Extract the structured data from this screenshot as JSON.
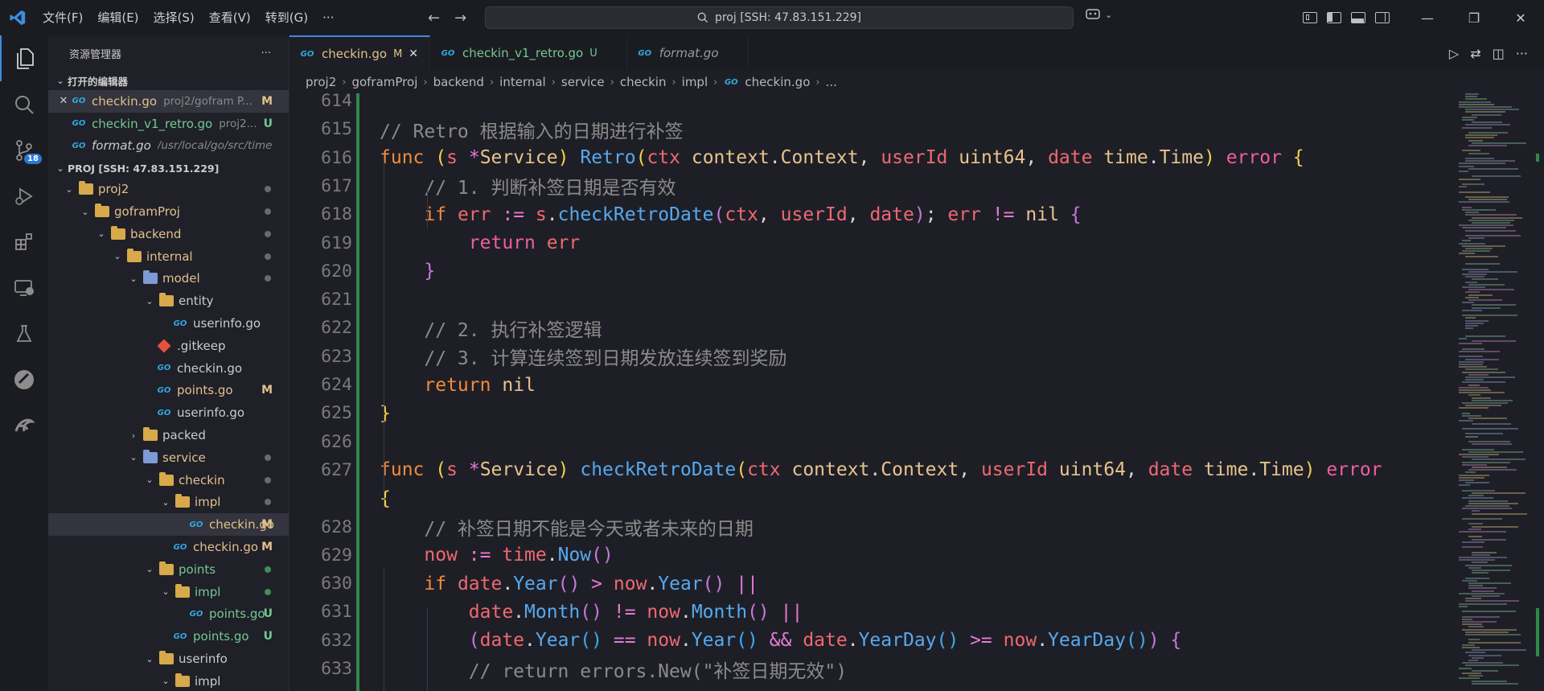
{
  "menu": [
    "文件(F)",
    "编辑(E)",
    "选择(S)",
    "查看(V)",
    "转到(G)",
    "···"
  ],
  "search": {
    "text": "proj [SSH: 47.83.151.229]"
  },
  "activity_badge": "18",
  "sidebar": {
    "title": "资源管理器",
    "more": "···",
    "open_editors_label": "打开的编辑器",
    "open_editors": [
      {
        "name": "checkin.go",
        "desc": "proj2/gofram P...",
        "status": "M",
        "close": "✕"
      },
      {
        "name": "checkin_v1_retro.go",
        "desc": "proj2...",
        "status": "U"
      },
      {
        "name": "format.go",
        "desc": "/usr/local/go/src/time",
        "status": ""
      }
    ],
    "project_label": "PROJ [SSH: 47.83.151.229]",
    "tree": [
      {
        "name": "proj2",
        "type": "folder",
        "chev": "⌄",
        "level": 0,
        "marker": "dot"
      },
      {
        "name": "goframProj",
        "type": "folder",
        "chev": "⌄",
        "level": 1,
        "marker": "dot"
      },
      {
        "name": "backend",
        "type": "folder",
        "chev": "⌄",
        "level": 2,
        "marker": "dot"
      },
      {
        "name": "internal",
        "type": "folder",
        "chev": "⌄",
        "level": 3,
        "marker": "dot"
      },
      {
        "name": "model",
        "type": "special",
        "chev": "⌄",
        "level": 4,
        "marker": "dot"
      },
      {
        "name": "entity",
        "type": "folder",
        "chev": "⌄",
        "level": 5,
        "marker": ""
      },
      {
        "name": "userinfo.go",
        "type": "go",
        "level": 6,
        "marker": ""
      },
      {
        "name": ".gitkeep",
        "type": "git",
        "level": 5,
        "marker": ""
      },
      {
        "name": "checkin.go",
        "type": "go",
        "level": 5,
        "marker": ""
      },
      {
        "name": "points.go",
        "type": "go",
        "level": 5,
        "marker": "M"
      },
      {
        "name": "userinfo.go",
        "type": "go",
        "level": 5,
        "marker": ""
      },
      {
        "name": "packed",
        "type": "folder",
        "chev": "›",
        "level": 4,
        "marker": ""
      },
      {
        "name": "service",
        "type": "special",
        "chev": "⌄",
        "level": 4,
        "marker": "dot"
      },
      {
        "name": "checkin",
        "type": "folder",
        "chev": "⌄",
        "level": 5,
        "marker": "dot"
      },
      {
        "name": "impl",
        "type": "folder",
        "chev": "⌄",
        "level": 6,
        "marker": "dot"
      },
      {
        "name": "checkin.go",
        "type": "go",
        "level": 7,
        "marker": "M",
        "selected": true
      },
      {
        "name": "checkin.go",
        "type": "go",
        "level": 6,
        "marker": "M"
      },
      {
        "name": "points",
        "type": "folder",
        "chev": "⌄",
        "level": 5,
        "marker": "greendot"
      },
      {
        "name": "impl",
        "type": "folder",
        "chev": "⌄",
        "level": 6,
        "marker": "greendot"
      },
      {
        "name": "points.go",
        "type": "go",
        "level": 7,
        "marker": "U"
      },
      {
        "name": "points.go",
        "type": "go",
        "level": 6,
        "marker": "U"
      },
      {
        "name": "userinfo",
        "type": "folder",
        "chev": "⌄",
        "level": 5,
        "marker": ""
      },
      {
        "name": "impl",
        "type": "folder",
        "chev": "⌄",
        "level": 6,
        "marker": ""
      }
    ]
  },
  "tabs": [
    {
      "name": "checkin.go",
      "status": "M",
      "close": "✕",
      "active": true
    },
    {
      "name": "checkin_v1_retro.go",
      "status": "U"
    },
    {
      "name": "format.go",
      "status": ""
    }
  ],
  "breadcrumb": [
    "proj2",
    "goframProj",
    "backend",
    "internal",
    "service",
    "checkin",
    "impl",
    "checkin.go",
    "..."
  ],
  "code_lines": [
    {
      "n": "614",
      "html": ""
    },
    {
      "n": "615",
      "html": "<span class='cm'>// Retro 根据输入的日期进行补签</span>"
    },
    {
      "n": "616",
      "html": "<span class='kw'>func</span> <span class='br1'>(</span><span class='pa'>s</span> <span class='op'>*</span><span class='ty'>Service</span><span class='br1'>)</span> <span class='fn'>Retro</span><span class='br1'>(</span><span class='pa'>ctx</span> <span class='ty'>context</span><span class='tx'>.</span><span class='ty'>Context</span><span class='tx'>,</span> <span class='pa'>userId</span> <span class='ty'>uint64</span><span class='tx'>,</span> <span class='pa'>date</span> <span class='ty'>time</span><span class='tx'>.</span><span class='ty'>Time</span><span class='br1'>)</span> <span class='pink'>error</span> <span class='br1'>{</span>"
    },
    {
      "n": "617",
      "html": "    <span class='cm'>// 1. 判断补签日期是否有效</span>"
    },
    {
      "n": "618",
      "html": "    <span class='kw'>if</span> <span class='pa'>err</span> <span class='op'>:=</span> <span class='pa'>s</span><span class='tx'>.</span><span class='fn'>checkRetroDate</span><span class='br2'>(</span><span class='pa'>ctx</span><span class='tx'>,</span> <span class='pa'>userId</span><span class='tx'>,</span> <span class='pa'>date</span><span class='br2'>)</span><span class='tx'>;</span> <span class='pa'>err</span> <span class='op'>!=</span> <span class='ty'>nil</span> <span class='br2'>{</span>"
    },
    {
      "n": "619",
      "html": "        <span class='pink'>return</span> <span class='pa'>err</span>"
    },
    {
      "n": "620",
      "html": "    <span class='br2'>}</span>"
    },
    {
      "n": "621",
      "html": ""
    },
    {
      "n": "622",
      "html": "    <span class='cm'>// 2. 执行补签逻辑</span>"
    },
    {
      "n": "623",
      "html": "    <span class='cm'>// 3. 计算连续签到日期发放连续签到奖励</span>"
    },
    {
      "n": "624",
      "html": "    <span class='kw'>return</span> <span class='ty'>nil</span>"
    },
    {
      "n": "625",
      "html": "<span class='br1'>}</span>"
    },
    {
      "n": "626",
      "html": ""
    },
    {
      "n": "627",
      "html": "<span class='kw'>func</span> <span class='br1'>(</span><span class='pa'>s</span> <span class='op'>*</span><span class='ty'>Service</span><span class='br1'>)</span> <span class='fn'>checkRetroDate</span><span class='br1'>(</span><span class='pa'>ctx</span> <span class='ty'>context</span><span class='tx'>.</span><span class='ty'>Context</span><span class='tx'>,</span> <span class='pa'>userId</span> <span class='ty'>uint64</span><span class='tx'>,</span> <span class='pa'>date</span> <span class='ty'>time</span><span class='tx'>.</span><span class='ty'>Time</span><span class='br1'>)</span> <span class='pink'>error</span>"
    },
    {
      "n": "",
      "html": "<span class='br1'>{</span>"
    },
    {
      "n": "628",
      "html": "    <span class='cm'>// 补签日期不能是今天或者未来的日期</span>"
    },
    {
      "n": "629",
      "html": "    <span class='pa'>now</span> <span class='op'>:=</span> <span class='pa'>time</span><span class='tx'>.</span><span class='fn'>Now</span><span class='br2'>()</span>"
    },
    {
      "n": "630",
      "html": "    <span class='kw'>if</span> <span class='pa'>date</span><span class='tx'>.</span><span class='fn'>Year</span><span class='br2'>()</span> <span class='op'>&gt;</span> <span class='pa'>now</span><span class='tx'>.</span><span class='fn'>Year</span><span class='br2'>()</span> <span class='op'>||</span>"
    },
    {
      "n": "631",
      "html": "        <span class='pa'>date</span><span class='tx'>.</span><span class='fn'>Month</span><span class='br2'>()</span> <span class='op'>!=</span> <span class='pa'>now</span><span class='tx'>.</span><span class='fn'>Month</span><span class='br2'>()</span> <span class='op'>||</span>"
    },
    {
      "n": "632",
      "html": "        <span class='br2'>(</span><span class='pa'>date</span><span class='tx'>.</span><span class='fn'>Year</span><span class='br3'>()</span> <span class='op'>==</span> <span class='pa'>now</span><span class='tx'>.</span><span class='fn'>Year</span><span class='br3'>()</span> <span class='op'>&amp;&amp;</span> <span class='pa'>date</span><span class='tx'>.</span><span class='fn'>YearDay</span><span class='br3'>()</span> <span class='op'>&gt;=</span> <span class='pa'>now</span><span class='tx'>.</span><span class='fn'>YearDay</span><span class='br3'>()</span><span class='br2'>)</span> <span class='br2'>{</span>"
    },
    {
      "n": "633",
      "html": "        <span class='cm'>// return errors.New(\"补签日期无效\")</span>"
    }
  ]
}
